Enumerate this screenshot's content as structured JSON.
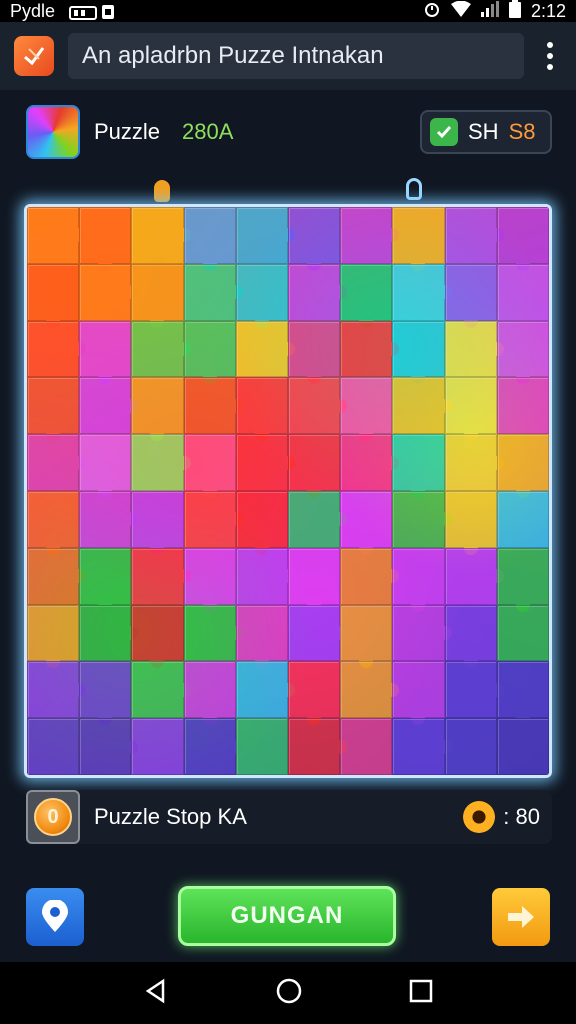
{
  "status_bar": {
    "app_name": "Pydle",
    "time": "2:12"
  },
  "app_bar": {
    "title": "An apladrbn Puzze Intnakan"
  },
  "puzzle_header": {
    "label": "Puzzle",
    "score": "280A",
    "badge_left": "SH",
    "badge_right": "S8"
  },
  "board": {
    "rows": 10,
    "cols": 10,
    "colors": [
      [
        "#ff7a1a",
        "#ff6a1a",
        "#f5b21a",
        "#4aa0f0",
        "#2ab0e8",
        "#7a4af0",
        "#c03ae0",
        "#f5b21a",
        "#a94af0",
        "#b03adf"
      ],
      [
        "#ff5a1a",
        "#ff7a1a",
        "#f59a1a",
        "#2ed08a",
        "#22c8d8",
        "#c040e8",
        "#22c070",
        "#3ad0e0",
        "#8a5af0",
        "#c050f0"
      ],
      [
        "#ff4a2a",
        "#e040e8",
        "#5ad050",
        "#3ad060",
        "#f0d020",
        "#e0408a",
        "#ff3030",
        "#22c8d8",
        "#f0e040",
        "#d050e8"
      ],
      [
        "#f05030",
        "#d040f0",
        "#f0a020",
        "#f05a20",
        "#ff3a30",
        "#ff4040",
        "#ff50a0",
        "#f0c020",
        "#f0e040",
        "#e040c0"
      ],
      [
        "#e040b0",
        "#e060f0",
        "#90e060",
        "#ff5080",
        "#ff3030",
        "#ff3030",
        "#ff3080",
        "#2ad0a0",
        "#f0d030",
        "#f0b020"
      ],
      [
        "#ff6020",
        "#d040e0",
        "#c040f0",
        "#ff4040",
        "#ff2a2a",
        "#30c060",
        "#e040f0",
        "#40c040",
        "#f0d020",
        "#30c8e0"
      ],
      [
        "#f07020",
        "#30c040",
        "#ff3040",
        "#e040f0",
        "#c040f0",
        "#e040f0",
        "#f08a20",
        "#d040f0",
        "#c040f0",
        "#30c040"
      ],
      [
        "#f0a020",
        "#30b040",
        "#e02a2a",
        "#30c040",
        "#e040c0",
        "#a040f0",
        "#f0a020",
        "#c040e0",
        "#8040e0",
        "#30c040"
      ],
      [
        "#8a40e0",
        "#7040d0",
        "#40c050",
        "#d040e0",
        "#30c0e0",
        "#ff3040",
        "#f0a020",
        "#c040e0",
        "#6040d0",
        "#5040c0"
      ],
      [
        "#6040c0",
        "#5a3ab8",
        "#8a40e0",
        "#5040c0",
        "#30c060",
        "#e03030",
        "#e04080",
        "#6040d0",
        "#5040c0",
        "#4a3ab0"
      ]
    ]
  },
  "info_bar": {
    "coin_symbol": "0",
    "label": "Puzzle  Stop KA",
    "value": ": 80"
  },
  "actions": {
    "main_button": "GUNGAN"
  }
}
